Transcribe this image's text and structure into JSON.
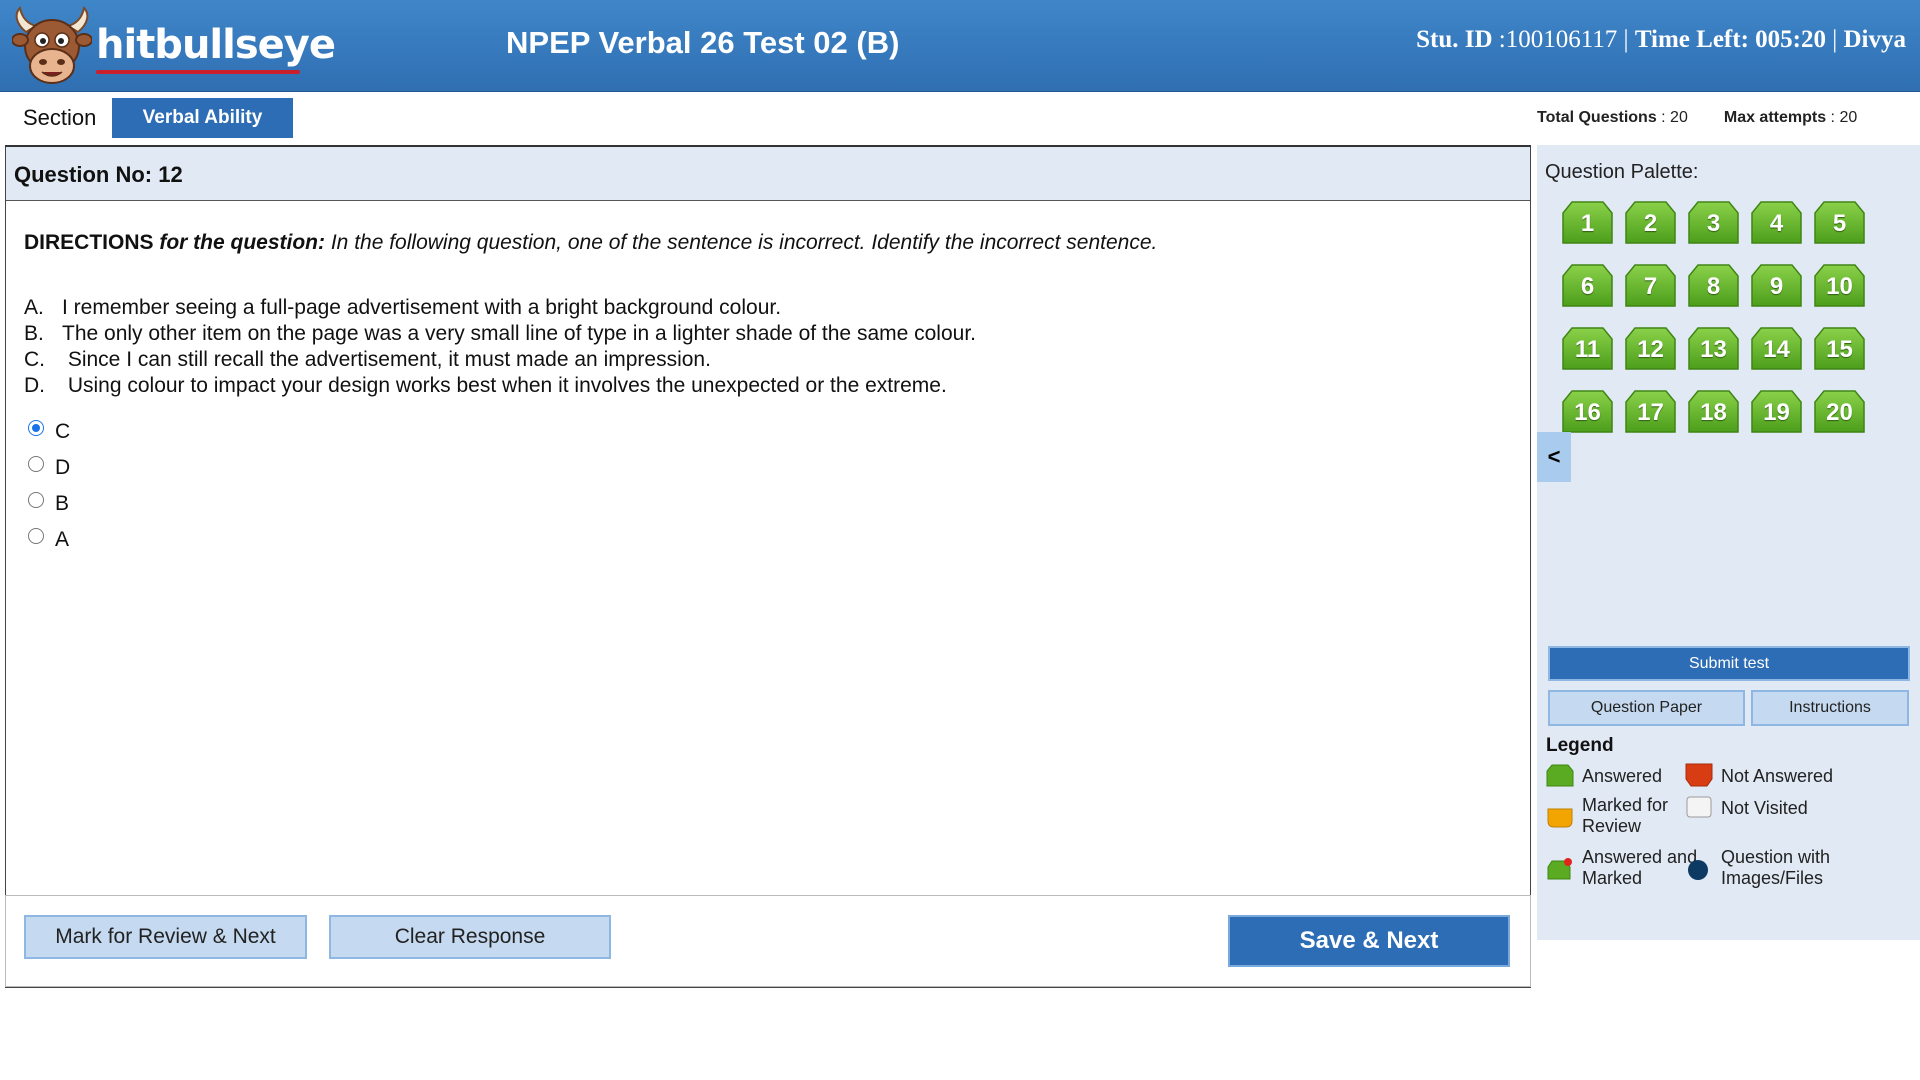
{
  "header": {
    "logo_text": "hitbullseye",
    "test_title": "NPEP Verbal 26 Test 02 (B)",
    "stu_id_label": "Stu. ID",
    "stu_id_value": " :100106117 | ",
    "time_left_label": "Time Left: 005:20",
    "separator": " | ",
    "user_name": "Divya"
  },
  "section": {
    "label": "Section",
    "active_tab": "Verbal Ability",
    "total_questions_label": "Total Questions",
    "total_questions_value": " : 20",
    "max_attempts_label": "Max attempts",
    "max_attempts_value": " : 20"
  },
  "question": {
    "number_label": "Question No: 12",
    "directions_bold": "DIRECTIONS",
    "directions_bold_italic": " for the question:",
    "directions_text": " In the following question, one of the sentence is incorrect. Identify the incorrect sentence.",
    "sentences": [
      {
        "letter": "A.",
        "text": "I remember seeing a full-page advertisement with a bright background colour."
      },
      {
        "letter": "B.",
        "text": "The only other item on the page was a very small line of type in a lighter shade of the same colour."
      },
      {
        "letter": "C.",
        "text": " Since I can still recall the advertisement, it must made an impression."
      },
      {
        "letter": "D.",
        "text": " Using colour to impact your design works best when it involves the unexpected or the extreme."
      }
    ],
    "options": [
      {
        "label": "C",
        "selected": true
      },
      {
        "label": "D",
        "selected": false
      },
      {
        "label": "B",
        "selected": false
      },
      {
        "label": "A",
        "selected": false
      }
    ]
  },
  "footer": {
    "mark_review_label": "Mark for Review & Next",
    "clear_label": "Clear Response",
    "save_next_label": "Save & Next"
  },
  "palette": {
    "title": "Question Palette:",
    "questions": [
      "1",
      "2",
      "3",
      "4",
      "5",
      "6",
      "7",
      "8",
      "9",
      "10",
      "11",
      "12",
      "13",
      "14",
      "15",
      "16",
      "17",
      "18",
      "19",
      "20"
    ],
    "status": "answered",
    "collapse_label": "<"
  },
  "actions": {
    "submit_label": "Submit test",
    "question_paper_label": "Question Paper",
    "instructions_label": "Instructions"
  },
  "legend": {
    "title": "Legend",
    "answered": "Answered",
    "not_answered": "Not Answered",
    "marked_for_review_1": "Marked for",
    "marked_for_review_2": "Review",
    "not_visited": "Not Visited",
    "answered_marked_1": "Answered and",
    "answered_marked_2": "Marked",
    "images_files_1": "Question with",
    "images_files_2": "Images/Files"
  },
  "colors": {
    "header_blue": "#2f6fb2",
    "button_blue": "#2d6db5",
    "answered_green": "#5aab21",
    "not_answered_red": "#d83c12",
    "marked_orange": "#f2a500",
    "images_navy": "#0d3a63"
  }
}
